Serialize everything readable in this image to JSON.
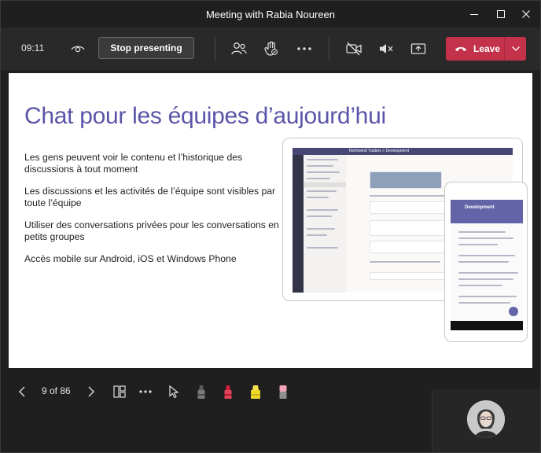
{
  "window": {
    "title": "Meeting with Rabia Noureen"
  },
  "toolbar": {
    "elapsed": "09:11",
    "stop_presenting_label": "Stop presenting",
    "leave_label": "Leave",
    "icons": [
      "eye-icon",
      "people-icon",
      "raise-hand-icon",
      "more-icon",
      "camera-off-icon",
      "speaker-muted-icon",
      "share-tray-icon",
      "phone-hangup-icon",
      "chevron-down-icon"
    ]
  },
  "slide": {
    "title": "Chat pour les équipes d’aujourd’hui",
    "bullets": [
      "Les gens peuvent voir le contenu et l’historique des discussions à tout moment",
      "Les discussions et les activités de l’équipe sont visibles par toute l’équipe",
      "Utiliser des conversations privées pour les conversations en petits groupes",
      "Accès mobile sur Android, iOS et Windows Phone"
    ],
    "image": {
      "desktop_header": "Northwind Traders > Development",
      "phone_header": "Development"
    }
  },
  "presenter_controls": {
    "page_indicator": "9 of 86",
    "icons": [
      "chevron-left-icon",
      "chevron-right-icon",
      "slide-grid-icon",
      "more-icon",
      "laser-pointer-icon",
      "pen-black-icon",
      "pen-red-icon",
      "highlighter-yellow-icon",
      "eraser-icon"
    ]
  },
  "colors": {
    "accent_purple": "#5b55a8",
    "leave_red": "#c4314b",
    "toolbar_bg": "#292929",
    "window_bg": "#1f1f1f"
  }
}
